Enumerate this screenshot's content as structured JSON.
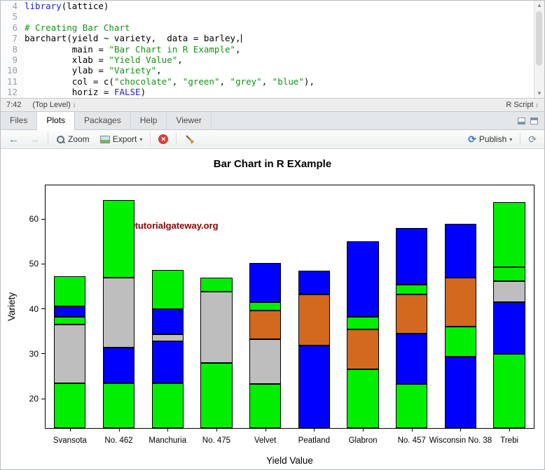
{
  "icons": {
    "back": "←",
    "forward": "→",
    "dropdown": "▾",
    "publish": "⟳",
    "refresh": "⟳",
    "updown": "↕",
    "scroll_up": "▲",
    "scroll_down": "▼",
    "delete": "✕"
  },
  "editor": {
    "lines": [
      {
        "n": "4",
        "tokens": [
          {
            "t": "library",
            "c": "kw"
          },
          {
            "t": "(lattice)",
            "c": "pl"
          }
        ]
      },
      {
        "n": "5",
        "tokens": []
      },
      {
        "n": "6",
        "tokens": [
          {
            "t": "# Creating Bar Chart",
            "c": "com"
          }
        ]
      },
      {
        "n": "7",
        "tokens": [
          {
            "t": "barchart(yield ~ variety,  data = barley,",
            "c": "pl"
          }
        ],
        "cursor": true
      },
      {
        "n": "8",
        "tokens": [
          {
            "t": "         main = ",
            "c": "pl"
          },
          {
            "t": "\"Bar Chart in R Example\"",
            "c": "str"
          },
          {
            "t": ",",
            "c": "pl"
          }
        ]
      },
      {
        "n": "9",
        "tokens": [
          {
            "t": "         xlab = ",
            "c": "pl"
          },
          {
            "t": "\"Yield Value\"",
            "c": "str"
          },
          {
            "t": ",",
            "c": "pl"
          }
        ]
      },
      {
        "n": "10",
        "tokens": [
          {
            "t": "         ylab = ",
            "c": "pl"
          },
          {
            "t": "\"Variety\"",
            "c": "str"
          },
          {
            "t": ",",
            "c": "pl"
          }
        ]
      },
      {
        "n": "11",
        "tokens": [
          {
            "t": "         col = c(",
            "c": "pl"
          },
          {
            "t": "\"chocolate\"",
            "c": "str"
          },
          {
            "t": ", ",
            "c": "pl"
          },
          {
            "t": "\"green\"",
            "c": "str"
          },
          {
            "t": ", ",
            "c": "pl"
          },
          {
            "t": "\"grey\"",
            "c": "str"
          },
          {
            "t": ", ",
            "c": "pl"
          },
          {
            "t": "\"blue\"",
            "c": "str"
          },
          {
            "t": "),",
            "c": "pl"
          }
        ]
      },
      {
        "n": "12",
        "tokens": [
          {
            "t": "         horiz = ",
            "c": "pl"
          },
          {
            "t": "FALSE",
            "c": "kw"
          },
          {
            "t": ")",
            "c": "pl"
          }
        ]
      }
    ]
  },
  "statusbar": {
    "position": "7:42",
    "scope": "(Top Level)",
    "filetype": "R Script"
  },
  "tabs": [
    {
      "label": "Files",
      "active": false
    },
    {
      "label": "Plots",
      "active": true
    },
    {
      "label": "Packages",
      "active": false
    },
    {
      "label": "Help",
      "active": false
    },
    {
      "label": "Viewer",
      "active": false
    }
  ],
  "toolbar": {
    "zoom_label": "Zoom",
    "export_label": "Export",
    "publish_label": "Publish"
  },
  "chart_data": {
    "type": "bar",
    "title": "Bar Chart in R EXample",
    "xlabel": "Yield Value",
    "ylabel": "Variety",
    "watermark": "©tutorialgateway.org",
    "yticks": [
      20,
      30,
      40,
      50,
      60
    ],
    "ylim": [
      13.5,
      67.5
    ],
    "grid": false,
    "colors": {
      "green": "#00EE00",
      "grey": "#BEBEBE",
      "blue": "#0000FF",
      "chocolate": "#D2691E"
    },
    "categories": [
      "Svansota",
      "No. 462",
      "Manchuria",
      "No. 475",
      "Velvet",
      "Peatland",
      "Glabron",
      "No. 457",
      "Wisconsin No. 38",
      "Trebi"
    ],
    "bars": [
      {
        "category": "Svansota",
        "segments": [
          [
            "green",
            23.5
          ],
          [
            "grey",
            36.5
          ],
          [
            "green",
            38.2
          ],
          [
            "blue",
            40.6
          ],
          [
            "green",
            47.2
          ]
        ]
      },
      {
        "category": "No. 462",
        "segments": [
          [
            "green",
            23.5
          ],
          [
            "blue",
            31.4
          ],
          [
            "grey",
            46.9
          ],
          [
            "green",
            64.3
          ]
        ]
      },
      {
        "category": "Manchuria",
        "segments": [
          [
            "green",
            23.5
          ],
          [
            "blue",
            32.8
          ],
          [
            "grey",
            34.3
          ],
          [
            "blue",
            40.0
          ],
          [
            "green",
            48.6
          ]
        ]
      },
      {
        "category": "No. 475",
        "segments": [
          [
            "green",
            28.0
          ],
          [
            "grey",
            43.8
          ],
          [
            "green",
            46.9
          ]
        ]
      },
      {
        "category": "Velvet",
        "segments": [
          [
            "green",
            23.3
          ],
          [
            "grey",
            33.2
          ],
          [
            "chocolate",
            39.7
          ],
          [
            "green",
            41.5
          ],
          [
            "blue",
            50.2
          ]
        ]
      },
      {
        "category": "Peatland",
        "segments": [
          [
            "blue",
            31.8
          ],
          [
            "chocolate",
            43.3
          ],
          [
            "blue",
            48.5
          ]
        ]
      },
      {
        "category": "Glabron",
        "segments": [
          [
            "green",
            26.5
          ],
          [
            "chocolate",
            35.5
          ],
          [
            "green",
            38.2
          ],
          [
            "blue",
            55.0
          ]
        ]
      },
      {
        "category": "No. 457",
        "segments": [
          [
            "green",
            23.3
          ],
          [
            "blue",
            34.5
          ],
          [
            "chocolate",
            43.3
          ],
          [
            "green",
            45.4
          ],
          [
            "blue",
            58.0
          ]
        ]
      },
      {
        "category": "Wisconsin No. 38",
        "segments": [
          [
            "blue",
            29.4
          ],
          [
            "green",
            36.0
          ],
          [
            "chocolate",
            47.0
          ],
          [
            "blue",
            58.9
          ]
        ]
      },
      {
        "category": "Trebi",
        "segments": [
          [
            "green",
            30.0
          ],
          [
            "blue",
            41.5
          ],
          [
            "grey",
            46.2
          ],
          [
            "green",
            49.3
          ],
          [
            "green",
            63.8
          ]
        ]
      }
    ]
  }
}
